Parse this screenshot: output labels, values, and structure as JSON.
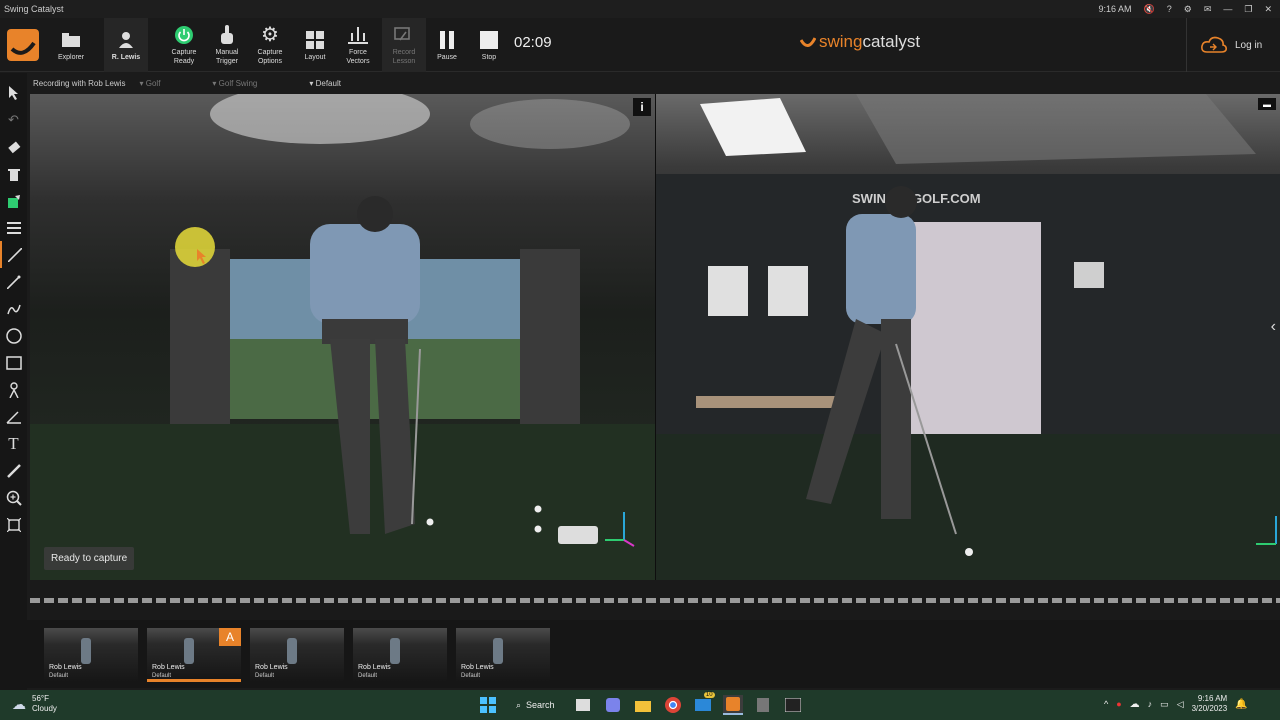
{
  "window": {
    "title": "Swing Catalyst",
    "time": "9:16 AM",
    "help": "?"
  },
  "toolbar": {
    "explorer": "Explorer",
    "user": "R. Lewis",
    "capture_ready": [
      "Capture",
      "Ready"
    ],
    "manual_trigger": [
      "Manual",
      "Trigger"
    ],
    "capture_options": [
      "Capture",
      "Options"
    ],
    "layout": "Layout",
    "force_vectors": [
      "Force",
      "Vectors"
    ],
    "record_lesson": [
      "Record",
      "Lesson"
    ],
    "pause": "Pause",
    "stop": "Stop",
    "timer": "02:09",
    "brand_prefix": "swing",
    "brand_suffix": "catalyst",
    "login": "Log in"
  },
  "session": {
    "recording": "Recording with Rob Lewis",
    "sport": "Golf",
    "activity": "Golf Swing",
    "preset": "Default"
  },
  "video": {
    "status": "Ready to capture",
    "info": "i",
    "cam2_signage": "SWING    E GOLF.COM"
  },
  "thumbnails": [
    {
      "name": "Rob Lewis",
      "preset": "Default",
      "badge": ""
    },
    {
      "name": "Rob Lewis",
      "preset": "Default",
      "badge": "A"
    },
    {
      "name": "Rob Lewis",
      "preset": "Default",
      "badge": ""
    },
    {
      "name": "Rob Lewis",
      "preset": "Default",
      "badge": ""
    },
    {
      "name": "Rob Lewis",
      "preset": "Default",
      "badge": ""
    }
  ],
  "taskbar": {
    "temperature": "56°F",
    "condition": "Cloudy",
    "search": "Search",
    "clock_time": "9:16 AM",
    "clock_date": "3/20/2023",
    "notif_count": "10"
  },
  "colors": {
    "accent": "#e8832a",
    "capture_green": "#2ecc71"
  }
}
